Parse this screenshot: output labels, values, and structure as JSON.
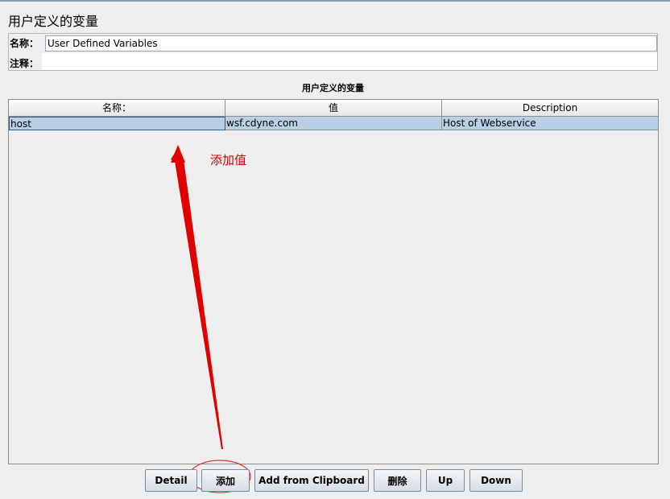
{
  "panel": {
    "title": "用户定义的变量",
    "name_label": "名称：",
    "name_value": "User Defined Variables",
    "comment_label": "注释：",
    "comment_value": ""
  },
  "table": {
    "caption": "用户定义的变量",
    "columns": [
      "名称：",
      "值",
      "Description"
    ],
    "rows": [
      {
        "name": "host",
        "value": "wsf.cdyne.com",
        "description": "Host of Webservice"
      }
    ]
  },
  "annotation": {
    "text": "添加值",
    "color": "#cc0000"
  },
  "buttons": {
    "detail": "Detail",
    "add": "添加",
    "add_from_clipboard": "Add from Clipboard",
    "delete": "删除",
    "up": "Up",
    "down": "Down"
  }
}
